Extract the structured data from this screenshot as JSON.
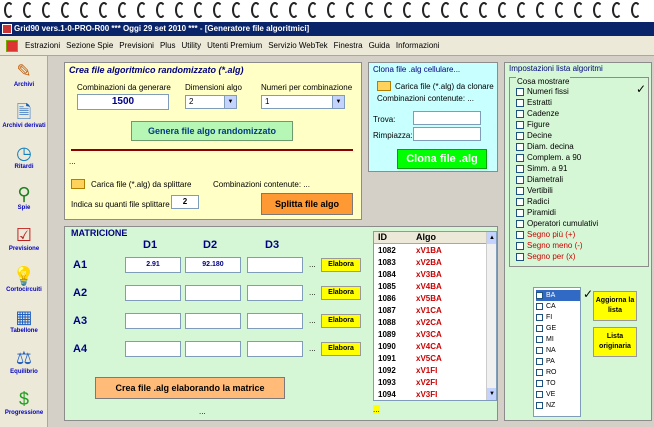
{
  "window": {
    "title": "Grid90 vers.1-0-PRO-R00  ***  Oggi 29 set 2010  ***  - [Generatore file algoritmici]"
  },
  "menu": [
    "Estrazioni",
    "Sezione Spie",
    "Previsioni",
    "Plus",
    "Utility",
    "Utenti Premium",
    "Servizio WebTek",
    "Finestra",
    "Guida",
    "Informazioni"
  ],
  "toolbar": [
    {
      "label": "Archivi",
      "icon": "✎"
    },
    {
      "label": "Archivi derivati",
      "icon": "🗎"
    },
    {
      "label": "Ritardi",
      "icon": "◷"
    },
    {
      "label": "Spie",
      "icon": "⚲"
    },
    {
      "label": "Previsione",
      "icon": "☑"
    },
    {
      "label": "Cortocircuiti",
      "icon": "💡"
    },
    {
      "label": "Tabellone",
      "icon": "▦"
    },
    {
      "label": "Equilibrio",
      "icon": "⚖"
    },
    {
      "label": "Progressione",
      "icon": "$"
    }
  ],
  "random": {
    "title": "Crea file algoritmico randomizzato (*.alg)",
    "comb_label": "Combinazioni da generare",
    "comb_value": "1500",
    "dim_label": "Dimensioni algo",
    "dim_value": "2",
    "num_label": "Numeri per combinazione",
    "num_value": "1",
    "generate_button": "Genera file algo randomizzato",
    "dots": "...",
    "load_label": "Carica file (*.alg) da splittare",
    "comb_contained": "Combinazioni contenute: ...",
    "split_label": "Indica su quanti file splittare",
    "split_value": "2",
    "split_button": "Splitta file algo"
  },
  "clone": {
    "title": "Clona file .alg cellulare...",
    "load_label": "Carica file (*.alg) da clonare",
    "comb_contained": "Combinazioni contenute: ...",
    "trova_label": "Trova:",
    "trova_value": "",
    "rimpiazza_label": "Rimpiazza:",
    "rimpiazza_value": "",
    "clone_button": "Clona file .alg"
  },
  "matrix": {
    "title": "MATRICIONE",
    "col_headers": [
      "D1",
      "D2",
      "D3"
    ],
    "row_labels": [
      "A1",
      "A2",
      "A3",
      "A4"
    ],
    "cells": [
      [
        "2.91",
        "92.180",
        ""
      ],
      [
        "",
        "",
        ""
      ],
      [
        "",
        "",
        ""
      ],
      [
        "",
        "",
        ""
      ]
    ],
    "row_dots": "...",
    "elabora_label": "Elabora",
    "create_button": "Crea file .alg elaborando la matrice",
    "bottom_dots": "..."
  },
  "alglist": {
    "headers": [
      "ID",
      "Algo"
    ],
    "rows": [
      [
        "1082",
        "xV1BA"
      ],
      [
        "1083",
        "xV2BA"
      ],
      [
        "1084",
        "xV3BA"
      ],
      [
        "1085",
        "xV4BA"
      ],
      [
        "1086",
        "xV5BA"
      ],
      [
        "1087",
        "xV1CA"
      ],
      [
        "1088",
        "xV2CA"
      ],
      [
        "1089",
        "xV3CA"
      ],
      [
        "1090",
        "xV4CA"
      ],
      [
        "1091",
        "xV5CA"
      ],
      [
        "1092",
        "xV1FI"
      ],
      [
        "1093",
        "xV2FI"
      ],
      [
        "1094",
        "xV3FI"
      ]
    ],
    "bottom_dots": "..."
  },
  "settings": {
    "title": "Impostazioni lista algoritmi",
    "group_title": "Cosa mostrare",
    "checks": [
      {
        "label": "Numeri fissi",
        "red": false
      },
      {
        "label": "Estratti",
        "red": false
      },
      {
        "label": "Cadenze",
        "red": false
      },
      {
        "label": "Figure",
        "red": false
      },
      {
        "label": "Decine",
        "red": false
      },
      {
        "label": "Diam. decina",
        "red": false
      },
      {
        "label": "Complem. a 90",
        "red": false
      },
      {
        "label": "Simm. a 91",
        "red": false
      },
      {
        "label": "Diametrali",
        "red": false
      },
      {
        "label": "Vertibili",
        "red": false
      },
      {
        "label": "Radici",
        "red": false
      },
      {
        "label": "Piramidi",
        "red": false
      },
      {
        "label": "Operatori cumulativi",
        "red": false
      },
      {
        "label": "Segno più (+)",
        "red": true
      },
      {
        "label": "Segno meno (-)",
        "red": true
      },
      {
        "label": "Segno per (x)",
        "red": true
      }
    ],
    "codes": [
      "BA",
      "CA",
      "FI",
      "GE",
      "MI",
      "NA",
      "PA",
      "RO",
      "TO",
      "VE",
      "NZ"
    ],
    "update_button": "Aggiorna la lista",
    "orig_button": "Lista originaria"
  },
  "colors": {
    "titlebar": "#0a246a",
    "yellow_panel": "#ffffc6",
    "cyan_panel": "#c8ffff",
    "green_panel": "#d6f7d6",
    "algo_text": "#cc0000"
  }
}
